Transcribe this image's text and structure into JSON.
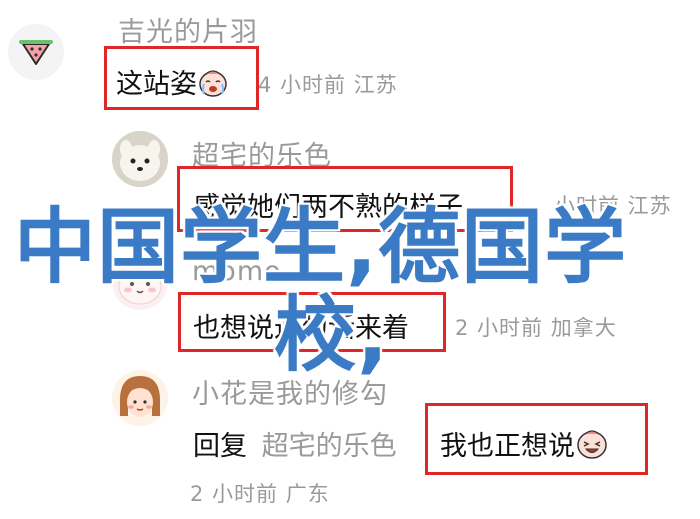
{
  "comments": [
    {
      "name": "吉光的片羽",
      "text": "这站姿",
      "meta": "4 小时前  江苏"
    },
    {
      "name": "超宅的乐色",
      "text": "感觉她们两不熟的样子",
      "meta": "小时前  江苏"
    },
    {
      "name": "momo",
      "text": "也想说这句话来着",
      "meta": "2 小时前  加拿大"
    },
    {
      "name": "小花是我的修勾",
      "reply_word": "回复",
      "reply_to": "超宅的乐色",
      "text": "我也正想说",
      "meta": "2 小时前  广东"
    }
  ],
  "overlay": {
    "line1": "中国学生,德国学",
    "line2": "校,"
  },
  "colors": {
    "highlight_box": "#e02727",
    "overlay_text": "#3b7bc6",
    "muted_text": "#9a9a9a"
  },
  "icons": [
    "watermelon-avatar-icon",
    "dog-avatar-icon",
    "cat-avatar-icon",
    "girl-avatar-icon",
    "crying-emoji-icon",
    "laughing-emoji-icon"
  ]
}
